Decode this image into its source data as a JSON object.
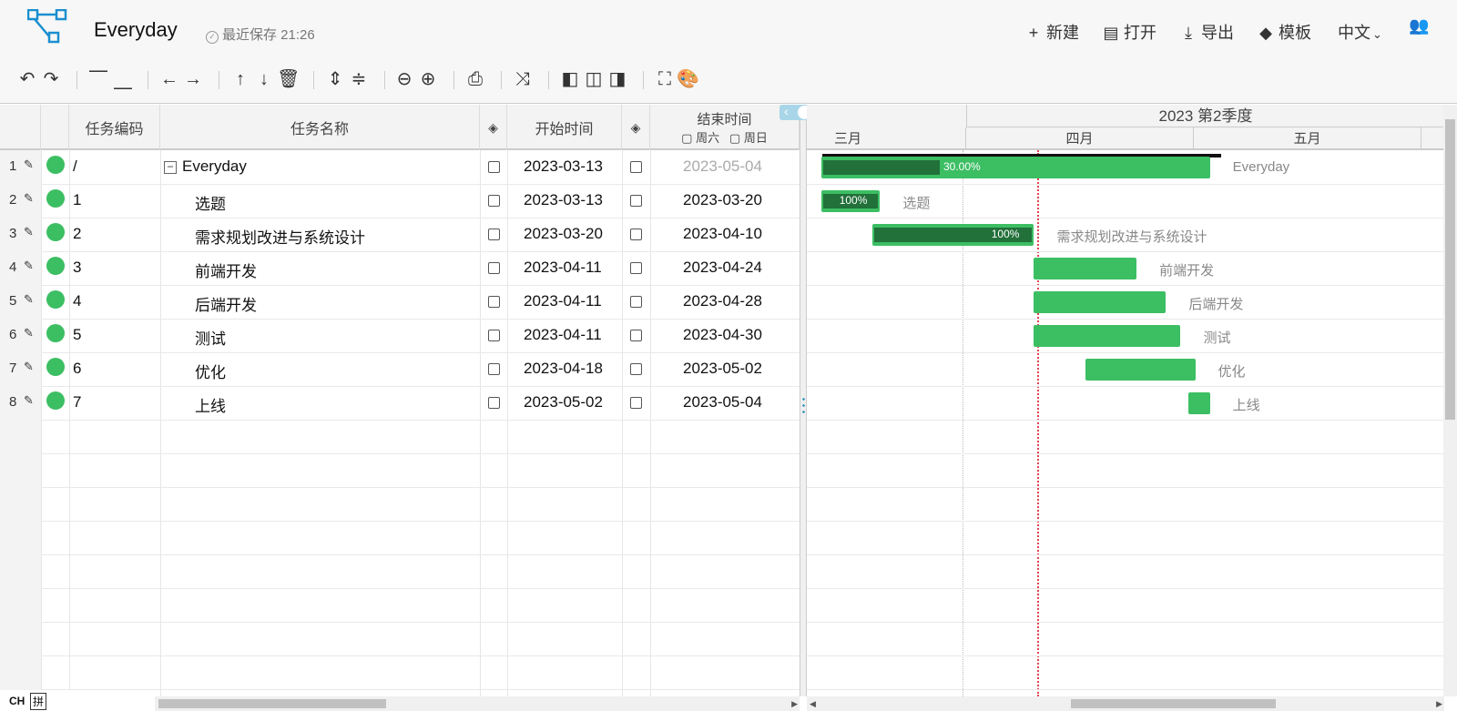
{
  "header": {
    "title": "Everyday",
    "save_status": "最近保存 21:26",
    "nav": {
      "new": "新建",
      "open": "打开",
      "export": "导出",
      "template": "模板",
      "language": "中文"
    }
  },
  "columns": {
    "code": "任务编码",
    "name": "任务名称",
    "start": "开始时间",
    "end": "结束时间",
    "sat": "周六",
    "sun": "周日"
  },
  "rows": [
    {
      "num": "1",
      "code": "/",
      "name": "Everyday",
      "start": "2023-03-13",
      "end": "2023-05-04"
    },
    {
      "num": "2",
      "code": "1",
      "name": "选题",
      "start": "2023-03-13",
      "end": "2023-03-20"
    },
    {
      "num": "3",
      "code": "2",
      "name": "需求规划改进与系统设计",
      "start": "2023-03-20",
      "end": "2023-04-10"
    },
    {
      "num": "4",
      "code": "3",
      "name": "前端开发",
      "start": "2023-04-11",
      "end": "2023-04-24"
    },
    {
      "num": "5",
      "code": "4",
      "name": "后端开发",
      "start": "2023-04-11",
      "end": "2023-04-28"
    },
    {
      "num": "6",
      "code": "5",
      "name": "测试",
      "start": "2023-04-11",
      "end": "2023-04-30"
    },
    {
      "num": "7",
      "code": "6",
      "name": "优化",
      "start": "2023-04-18",
      "end": "2023-05-02"
    },
    {
      "num": "8",
      "code": "7",
      "name": "上线",
      "start": "2023-05-02",
      "end": "2023-05-04"
    }
  ],
  "gantt": {
    "quarter": "2023 第2季度",
    "months": [
      "三月",
      "四月",
      "五月"
    ],
    "bars": [
      {
        "label": "Everyday",
        "progress_text": "30.00%",
        "progress": 0.3
      },
      {
        "label": "选题",
        "progress_text": "100%",
        "progress": 1.0
      },
      {
        "label": "需求规划改进与系统设计",
        "progress_text": "100%",
        "progress": 1.0
      },
      {
        "label": "前端开发"
      },
      {
        "label": "后端开发"
      },
      {
        "label": "测试"
      },
      {
        "label": "优化"
      },
      {
        "label": "上线"
      }
    ]
  },
  "ime": {
    "mode": "CH",
    "pinyin": "拼"
  },
  "colors": {
    "accent": "#3cbe63",
    "progress": "#22703a",
    "today_line": "#e0424f",
    "logo": "#1a8fd0"
  }
}
